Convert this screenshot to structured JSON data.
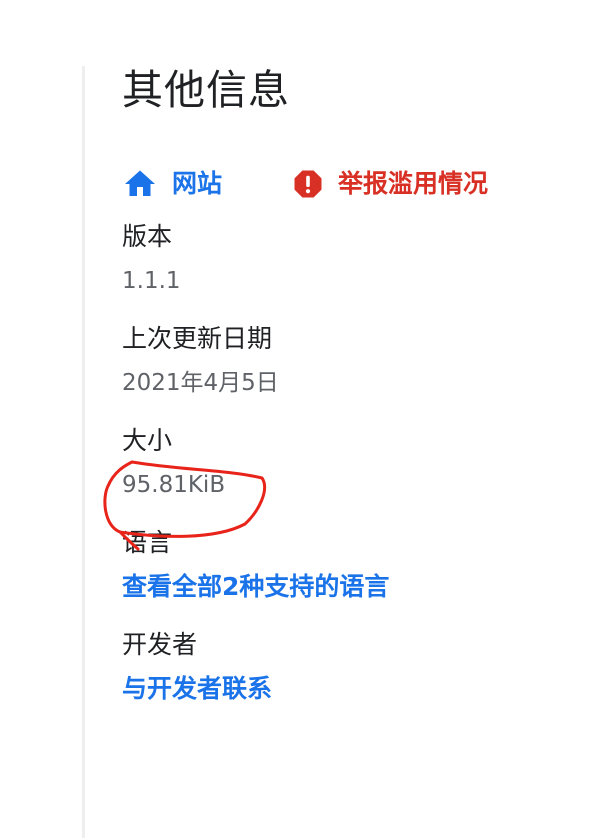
{
  "title": "其他信息",
  "links": {
    "website": {
      "label": "网站",
      "icon": "home-icon",
      "color": "#1a73e8"
    },
    "report": {
      "label": "举报滥用情况",
      "icon": "report-octagon-icon",
      "color": "#d93025"
    }
  },
  "details": {
    "version": {
      "label": "版本",
      "value": "1.1.1"
    },
    "updated": {
      "label": "上次更新日期",
      "value": "2021年4月5日"
    },
    "size": {
      "label": "大小",
      "value": "95.81KiB"
    },
    "languages": {
      "label": "语言",
      "link": "查看全部2种支持的语言"
    },
    "developer": {
      "label": "开发者",
      "link": "与开发者联系"
    }
  },
  "annotation": {
    "type": "hand-drawn-circle",
    "color": "#e8231a",
    "target": "size"
  }
}
